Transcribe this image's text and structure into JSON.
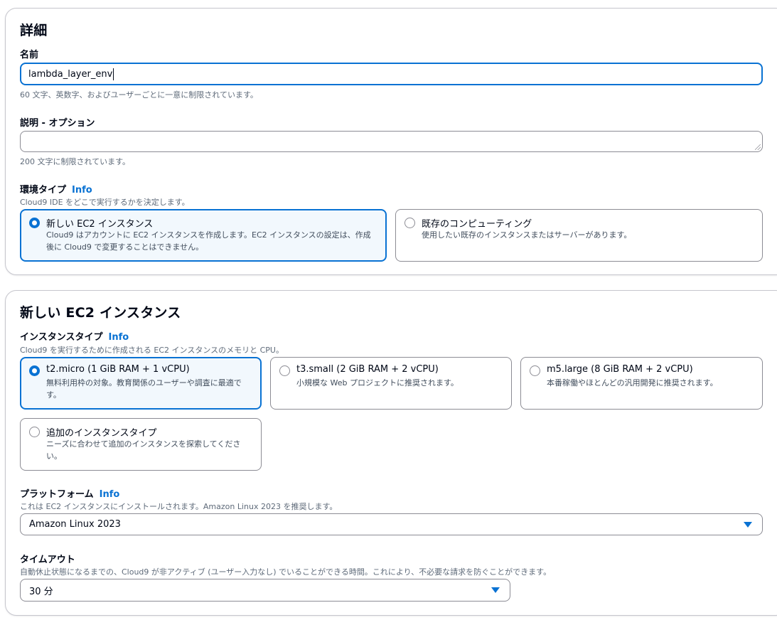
{
  "details": {
    "heading": "詳細",
    "name": {
      "label": "名前",
      "value": "lambda_layer_env",
      "hint": "60 文字、英数字、およびユーザーごとに一意に制限されています。"
    },
    "description": {
      "label": "説明 - オプション",
      "value": "",
      "hint": "200 文字に制限されています。"
    },
    "environment_type": {
      "label": "環境タイプ",
      "info": "Info",
      "hint": "Cloud9 IDE をどこで実行するかを決定します。",
      "options": [
        {
          "title": "新しい EC2 インスタンス",
          "desc": "Cloud9 はアカウントに EC2 インスタンスを作成します。EC2 インスタンスの設定は、作成後に Cloud9 で変更することはできません。",
          "selected": true
        },
        {
          "title": "既存のコンピューティング",
          "desc": "使用したい既存のインスタンスまたはサーバーがあります。",
          "selected": false
        }
      ]
    }
  },
  "ec2": {
    "heading": "新しい EC2 インスタンス",
    "instance_type": {
      "label": "インスタンスタイプ",
      "info": "Info",
      "hint": "Cloud9 を実行するために作成される EC2 インスタンスのメモリと CPU。",
      "options": [
        {
          "title": "t2.micro (1 GiB RAM + 1 vCPU)",
          "desc": "無料利用枠の対象。教育関係のユーザーや調査に最適です。",
          "selected": true
        },
        {
          "title": "t3.small (2 GiB RAM + 2 vCPU)",
          "desc": "小規模な Web プロジェクトに推奨されます。",
          "selected": false
        },
        {
          "title": "m5.large (8 GiB RAM + 2 vCPU)",
          "desc": "本番稼働やほとんどの汎用開発に推奨されます。",
          "selected": false
        },
        {
          "title": "追加のインスタンスタイプ",
          "desc": "ニーズに合わせて追加のインスタンスを探索してください。",
          "selected": false
        }
      ]
    },
    "platform": {
      "label": "プラットフォーム",
      "info": "Info",
      "hint": "これは EC2 インスタンスにインストールされます。Amazon Linux 2023 を推奨します。",
      "value": "Amazon Linux 2023"
    },
    "timeout": {
      "label": "タイムアウト",
      "hint": "自動休止状態になるまでの、Cloud9 が非アクティブ (ユーザー入力なし) でいることができる時間。これにより、不必要な請求を防ぐことができます。",
      "value": "30 分"
    }
  },
  "colors": {
    "accent": "#0972d3",
    "selected_bg": "#f2f8fd",
    "border": "#8c8c94",
    "hint": "#5f6b7a"
  }
}
